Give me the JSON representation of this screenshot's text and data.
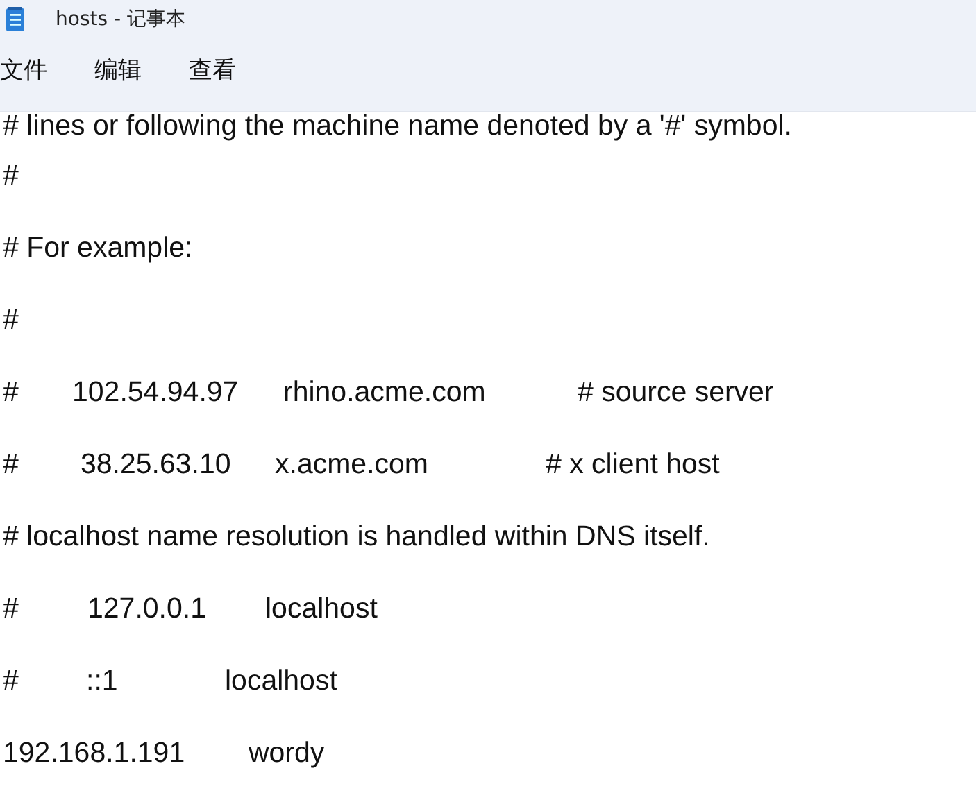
{
  "window": {
    "title": "hosts - 记事本"
  },
  "menu": [
    {
      "label": "文件"
    },
    {
      "label": "编辑"
    },
    {
      "label": "查看"
    }
  ],
  "lines": [
    {
      "parts": [
        "# lines or following the machine name denoted by a '#' symbol."
      ]
    },
    {
      "parts": [
        "#"
      ]
    },
    {
      "parts": [
        "# For example:"
      ]
    },
    {
      "parts": [
        "#"
      ]
    },
    {
      "parts": [
        "#",
        "102.54.94.97",
        "rhino.acme.com",
        "# source server"
      ]
    },
    {
      "parts": [
        "#",
        "38.25.63.10",
        "x.acme.com",
        "# x client host"
      ]
    },
    {
      "parts": [
        "# localhost name resolution is handled within DNS itself."
      ]
    },
    {
      "parts": [
        "#",
        "127.0.0.1",
        "localhost"
      ]
    },
    {
      "parts": [
        "#",
        "::1",
        "localhost"
      ]
    },
    {
      "parts": [
        "192.168.1.191",
        "wordy"
      ]
    }
  ]
}
